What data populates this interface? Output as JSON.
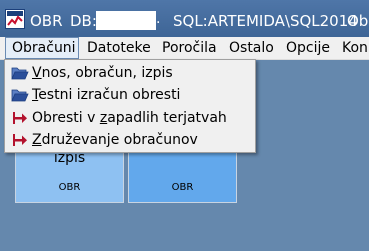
{
  "titlebar": {
    "app_name": "OBR",
    "db_label": "DB:",
    "db_dot": ".",
    "sql_label": "SQL:ARTEMIDA\\SQL2014",
    "overflow": "Ob"
  },
  "menubar": {
    "items": [
      {
        "label": "Obračuni"
      },
      {
        "label": "Datoteke"
      },
      {
        "label": "Poročila"
      },
      {
        "label": "Ostalo"
      },
      {
        "label": "Opcije"
      },
      {
        "label": "Kon"
      }
    ]
  },
  "dropdown": {
    "items": [
      {
        "pre": "",
        "u": "V",
        "post": "nos, obračun, izpis",
        "icon": "folder-open-icon"
      },
      {
        "pre": "",
        "u": "T",
        "post": "estni izračun obresti",
        "icon": "folder-open-icon"
      },
      {
        "pre": "Obresti v ",
        "u": "z",
        "post": "apadlih terjatvah",
        "icon": "arrow-right-icon"
      },
      {
        "pre": "",
        "u": "Z",
        "post": "druževanje obračunov",
        "icon": "arrow-right-icon"
      }
    ]
  },
  "tiles": [
    {
      "title": "izpis",
      "subtitle": "OBR"
    },
    {
      "title": "",
      "subtitle": "OBR"
    }
  ],
  "colors": {
    "desktop": "#6588ad",
    "tile_light": "#8ec1f2",
    "tile_dark": "#62a8ec",
    "arrow": "#b3122d",
    "folder": "#3a5fa8"
  }
}
